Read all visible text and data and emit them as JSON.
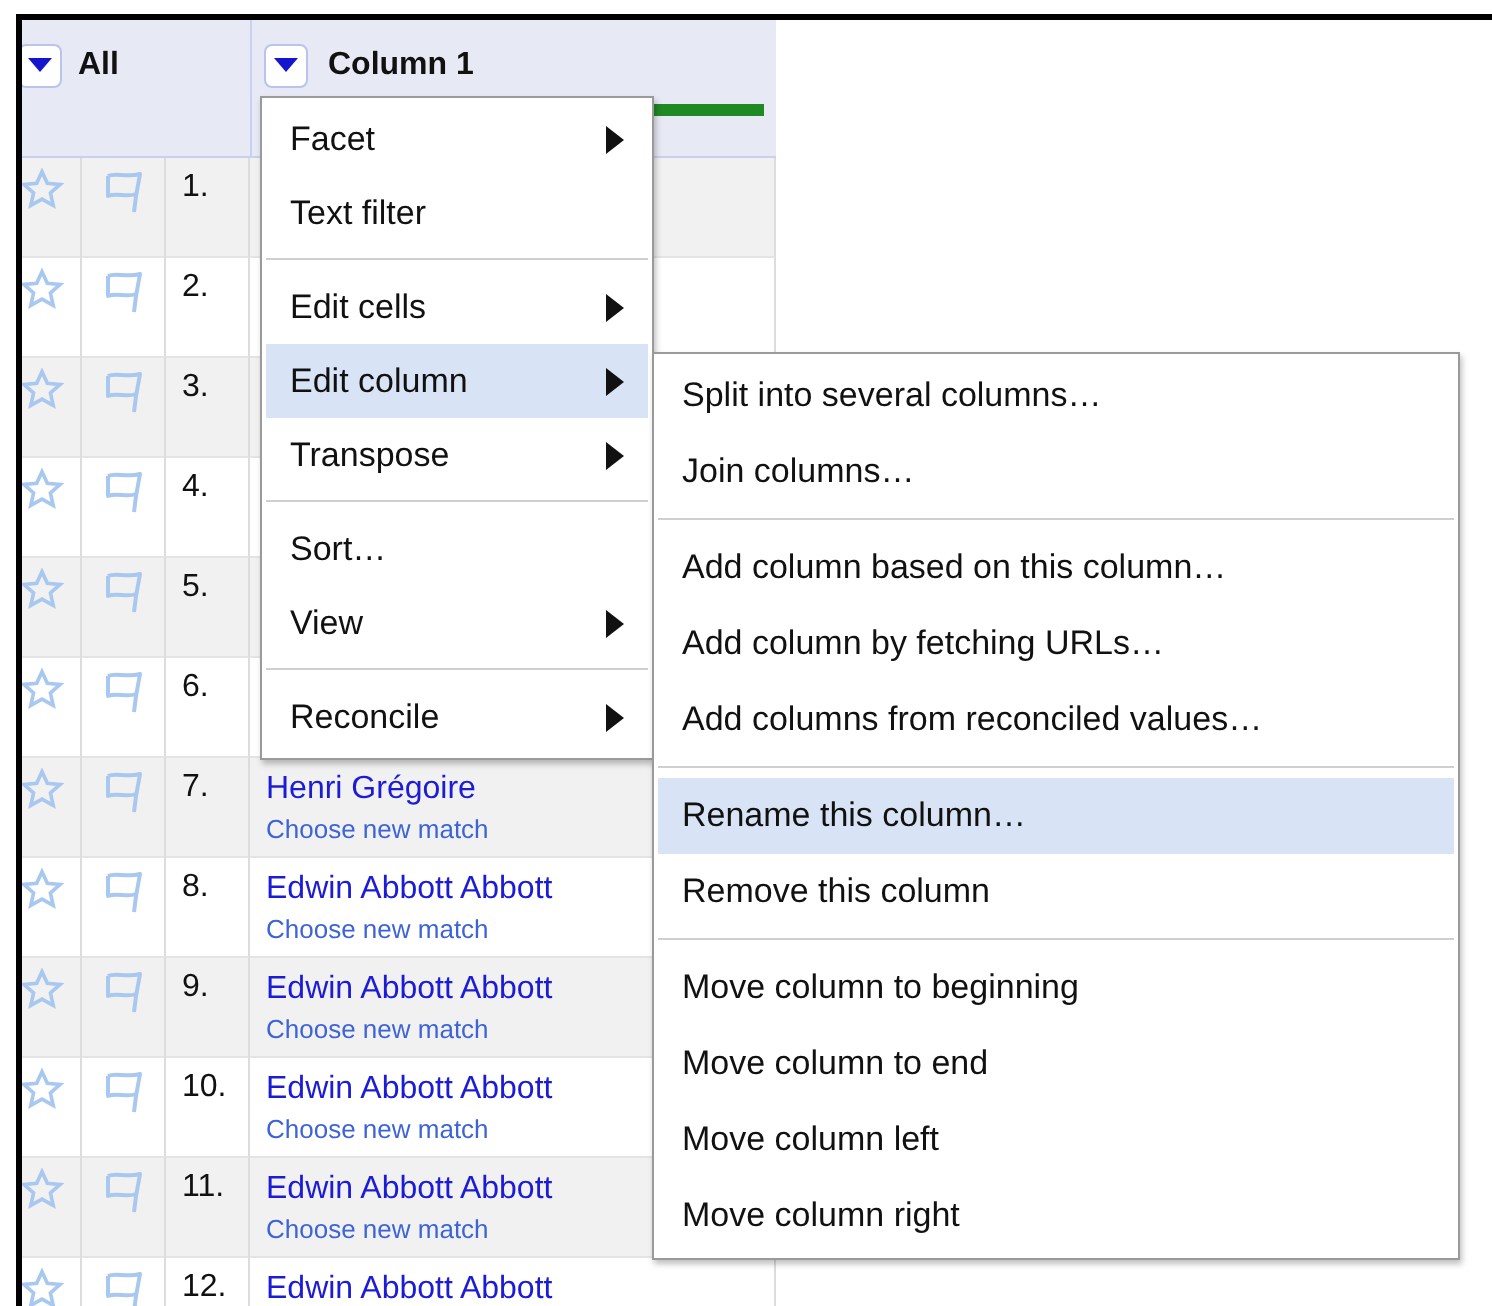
{
  "table": {
    "all_label": "All",
    "column_label": "Column 1",
    "rows": [
      {
        "number": "1."
      },
      {
        "number": "2."
      },
      {
        "number": "3."
      },
      {
        "number": "4."
      },
      {
        "number": "5."
      },
      {
        "number": "6."
      },
      {
        "number": "7.",
        "name": "Henri Grégoire",
        "match_link": "Choose new match"
      },
      {
        "number": "8.",
        "name": "Edwin Abbott Abbott",
        "match_link": "Choose new match"
      },
      {
        "number": "9.",
        "name": "Edwin Abbott Abbott",
        "match_link": "Choose new match"
      },
      {
        "number": "10.",
        "name": "Edwin Abbott Abbott",
        "match_link": "Choose new match"
      },
      {
        "number": "11.",
        "name": "Edwin Abbott Abbott",
        "match_link": "Choose new match"
      },
      {
        "number": "12.",
        "name": "Edwin Abbott Abbott"
      }
    ]
  },
  "column_menu": {
    "groups": [
      [
        {
          "label": "Facet",
          "submenu": true,
          "selected": false
        },
        {
          "label": "Text filter",
          "submenu": false,
          "selected": false
        }
      ],
      [
        {
          "label": "Edit cells",
          "submenu": true,
          "selected": false
        },
        {
          "label": "Edit column",
          "submenu": true,
          "selected": true
        },
        {
          "label": "Transpose",
          "submenu": true,
          "selected": false
        }
      ],
      [
        {
          "label": "Sort…",
          "submenu": false,
          "selected": false
        },
        {
          "label": "View",
          "submenu": true,
          "selected": false
        }
      ],
      [
        {
          "label": "Reconcile",
          "submenu": true,
          "selected": false
        }
      ]
    ]
  },
  "edit_column_submenu": {
    "groups": [
      [
        {
          "label": "Split into several columns…",
          "selected": false
        },
        {
          "label": "Join columns…",
          "selected": false
        }
      ],
      [
        {
          "label": "Add column based on this column…",
          "selected": false
        },
        {
          "label": "Add column by fetching URLs…",
          "selected": false
        },
        {
          "label": "Add columns from reconciled values…",
          "selected": false
        }
      ],
      [
        {
          "label": "Rename this column…",
          "selected": true
        },
        {
          "label": "Remove this column",
          "selected": false
        }
      ],
      [
        {
          "label": "Move column to beginning",
          "selected": false
        },
        {
          "label": "Move column to end",
          "selected": false
        },
        {
          "label": "Move column left",
          "selected": false
        },
        {
          "label": "Move column right",
          "selected": false
        }
      ]
    ]
  }
}
